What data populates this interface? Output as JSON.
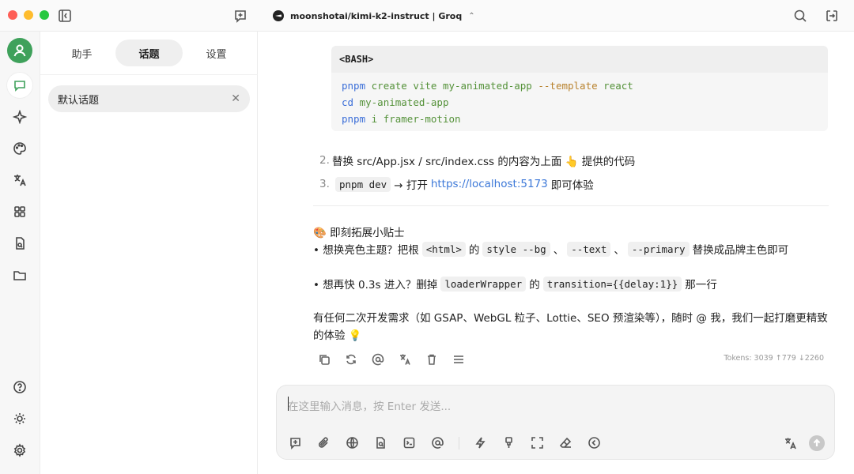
{
  "titlebar": {
    "model": "moonshotai/kimi-k2-instruct | Groq"
  },
  "panel": {
    "tabs": [
      {
        "label": "助手"
      },
      {
        "label": "话题"
      },
      {
        "label": "设置"
      }
    ],
    "topic": "默认话题"
  },
  "code": {
    "lang": "<BASH>",
    "lines": [
      {
        "cmd": "pnpm",
        "rest": "create vite my-animated-app",
        "flag": "--template",
        "tail": "react"
      },
      {
        "cmd": "cd",
        "rest": "my-animated-app"
      },
      {
        "cmd": "pnpm",
        "rest": "i framer-motion"
      }
    ]
  },
  "steps": [
    {
      "num": "2.",
      "text": "替换 src/App.jsx / src/index.css 的内容为上面 👆 提供的代码"
    },
    {
      "num": "3.",
      "code": "pnpm dev",
      "mid": "→ 打开",
      "link": "https://localhost:5173",
      "tail": "即可体验"
    }
  ],
  "tips": {
    "title": "🎨 即刻拓展小贴士",
    "t1_a": "• 想换亮色主题？把根",
    "t1_c1": "<html>",
    "t1_b": "的",
    "t1_c2": "style --bg",
    "t1_s1": "、",
    "t1_c3": "--text",
    "t1_s2": "、",
    "t1_c4": "--primary",
    "t1_end": "替换成品牌主色即可",
    "t2_a": "• 想再快 0.3s 进入？删掉",
    "t2_c1": "loaderWrapper",
    "t2_b": "的",
    "t2_c2": "transition={{delay:1}}",
    "t2_end": "那一行",
    "para": "有任何二次开发需求（如 GSAP、WebGL 粒子、Lottie、SEO 预渲染等），随时 @ 我，我们一起打磨更精致的体验 💡"
  },
  "tokens": "Tokens: 3039 ↑779 ↓2260",
  "input": {
    "placeholder": "在这里输入消息，按 Enter 发送..."
  }
}
